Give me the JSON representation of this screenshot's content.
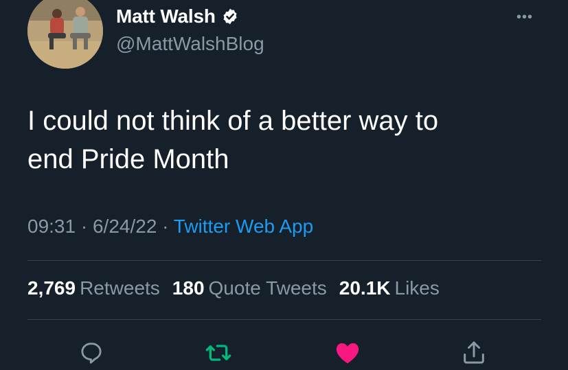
{
  "author": {
    "display_name": "Matt Walsh",
    "handle": "@MattWalshBlog",
    "verified": true
  },
  "more_icon": "more-icon",
  "tweet": {
    "text_line1": "I could not think of a better way to",
    "text_line2": "end Pride Month"
  },
  "meta": {
    "time": "09:31",
    "sep1": " · ",
    "date": "6/24/22",
    "sep2": " · ",
    "source": "Twitter Web App"
  },
  "stats": {
    "retweets_count": "2,769",
    "retweets_label": "Retweets",
    "quotes_count": "180",
    "quotes_label": "Quote Tweets",
    "likes_count": "20.1K",
    "likes_label": "Likes"
  },
  "actions": {
    "reply_icon": "reply-icon",
    "retweet_icon": "retweet-icon",
    "like_icon": "heart-icon",
    "share_icon": "share-icon"
  },
  "colors": {
    "background": "#15202b",
    "text": "#ffffff",
    "secondary": "#8b98a5",
    "link": "#1d9bf0",
    "retweet": "#00ba7c",
    "like": "#f91880"
  }
}
